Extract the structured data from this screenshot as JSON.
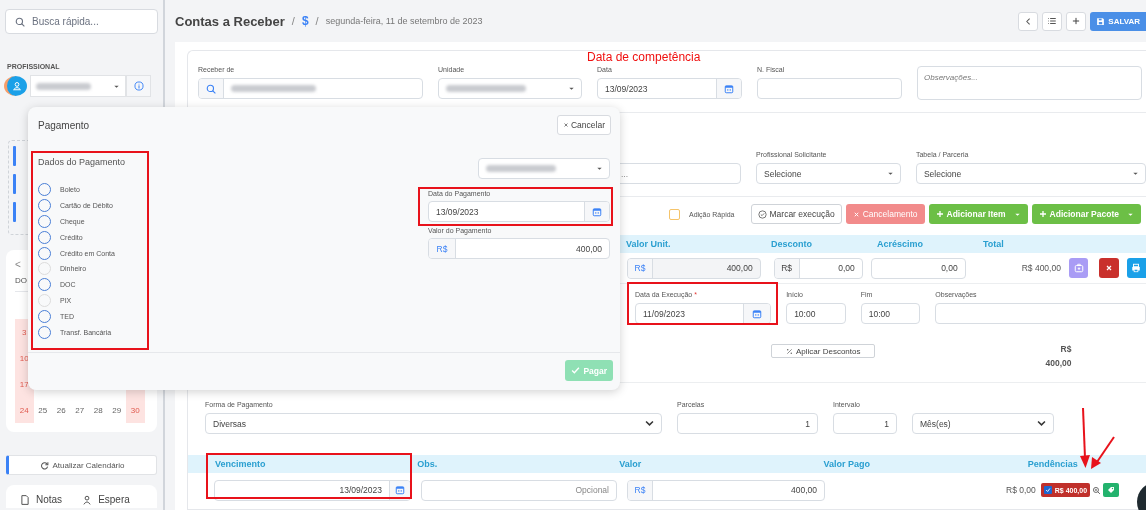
{
  "sidebar": {
    "search": {
      "placeholder": "Busca rápida..."
    },
    "professional_label": "PROFISSIONAL",
    "calendar": {
      "prev": "<",
      "weekday": "DO",
      "weeks": [
        [
          "3"
        ],
        [
          "10"
        ],
        [
          "17"
        ],
        [
          "24",
          "25",
          "26",
          "27",
          "28",
          "29",
          "30"
        ]
      ]
    },
    "refresh_button": "Atualizar Calendário",
    "bottom_tabs": [
      "Notas",
      "Espera"
    ]
  },
  "header": {
    "title": "Contas a Receber",
    "breadcrumb_separators": [
      "/",
      "/"
    ],
    "breadcrumb_icon": "$",
    "date": "segunda-feira, 11 de setembro de 2023",
    "save_button": "SALVAR"
  },
  "annotation": {
    "text": "Data de competência"
  },
  "form": {
    "fields": [
      {
        "label": "Receber de",
        "kind": "search"
      },
      {
        "label": "Unidade",
        "kind": "select"
      },
      {
        "label": "Data",
        "kind": "date",
        "value": "13/09/2023"
      },
      {
        "label": "N. Fiscal",
        "kind": "text"
      }
    ],
    "notes": {
      "placeholder": "Observações..."
    }
  },
  "request": {
    "partial_value": "...",
    "fields": [
      {
        "label": "Profissional Solicitante",
        "value": "Selecione"
      },
      {
        "label": "Tabela / Parceria",
        "value": "Selecione"
      }
    ]
  },
  "toolbar": {
    "quick_add": {
      "label": "Adição Rápida",
      "checked": false
    },
    "buttons": [
      {
        "label": "Marcar execução",
        "kind": "outline"
      },
      {
        "label": "Cancelamento",
        "kind": "danger"
      },
      {
        "label": "Adicionar Item",
        "kind": "success"
      },
      {
        "label": "Adicionar Pacote",
        "kind": "success"
      }
    ]
  },
  "items": {
    "columns": [
      "Valor Unit.",
      "Desconto",
      "Acréscimo",
      "Total"
    ],
    "row": {
      "unit_currency": "R$",
      "unit_value": "400,00",
      "discount_currency": "R$",
      "discount": "0,00",
      "addition": "0,00",
      "total": "R$ 400,00"
    },
    "execution": {
      "date_label": "Data da Execução",
      "required_mark": "*",
      "date": "11/09/2023",
      "start_label": "Início",
      "start": "10:00",
      "end_label": "Fim",
      "end": "10:00",
      "notes_label": "Observações"
    },
    "discount_button": "Aplicar Descontos",
    "sum": [
      "R$",
      "400,00"
    ]
  },
  "payment_plan": {
    "method_label": "Forma de Pagamento",
    "method": "Diversas",
    "installments_label": "Parcelas",
    "installments": "1",
    "interval_label": "Intervalo",
    "interval": "1",
    "interval_unit": "Mês(es)"
  },
  "installments": {
    "columns": [
      "Vencimento",
      "Obs.",
      "Valor",
      "Valor Pago",
      "Pendências"
    ],
    "rows": [
      {
        "due": "13/09/2023",
        "notes_placeholder": "Opcional",
        "currency": "R$",
        "value": "400,00",
        "paid": "R$ 0,00",
        "pending": "R$ 400,00",
        "pending_checked": true
      }
    ]
  },
  "modal": {
    "title": "Pagamento",
    "cancel": "Cancelar",
    "section_title": "Dados do Pagamento",
    "methods": [
      {
        "label": "Boleto",
        "disabled": false
      },
      {
        "label": "Cartão de Débito",
        "disabled": false
      },
      {
        "label": "Cheque",
        "disabled": false
      },
      {
        "label": "Crédito",
        "disabled": false
      },
      {
        "label": "Crédito em Conta",
        "disabled": false
      },
      {
        "label": "Dinheiro",
        "disabled": true
      },
      {
        "label": "DOC",
        "disabled": false
      },
      {
        "label": "PIX",
        "disabled": true
      },
      {
        "label": "TED",
        "disabled": false
      },
      {
        "label": "Transf. Bancária",
        "disabled": false
      }
    ],
    "date_label": "Data do Pagamento",
    "date": "13/09/2023",
    "value_label": "Valor do Pagamento",
    "currency": "R$",
    "value": "400,00",
    "pay_button": "Pagar",
    "pay_disabled": true
  }
}
